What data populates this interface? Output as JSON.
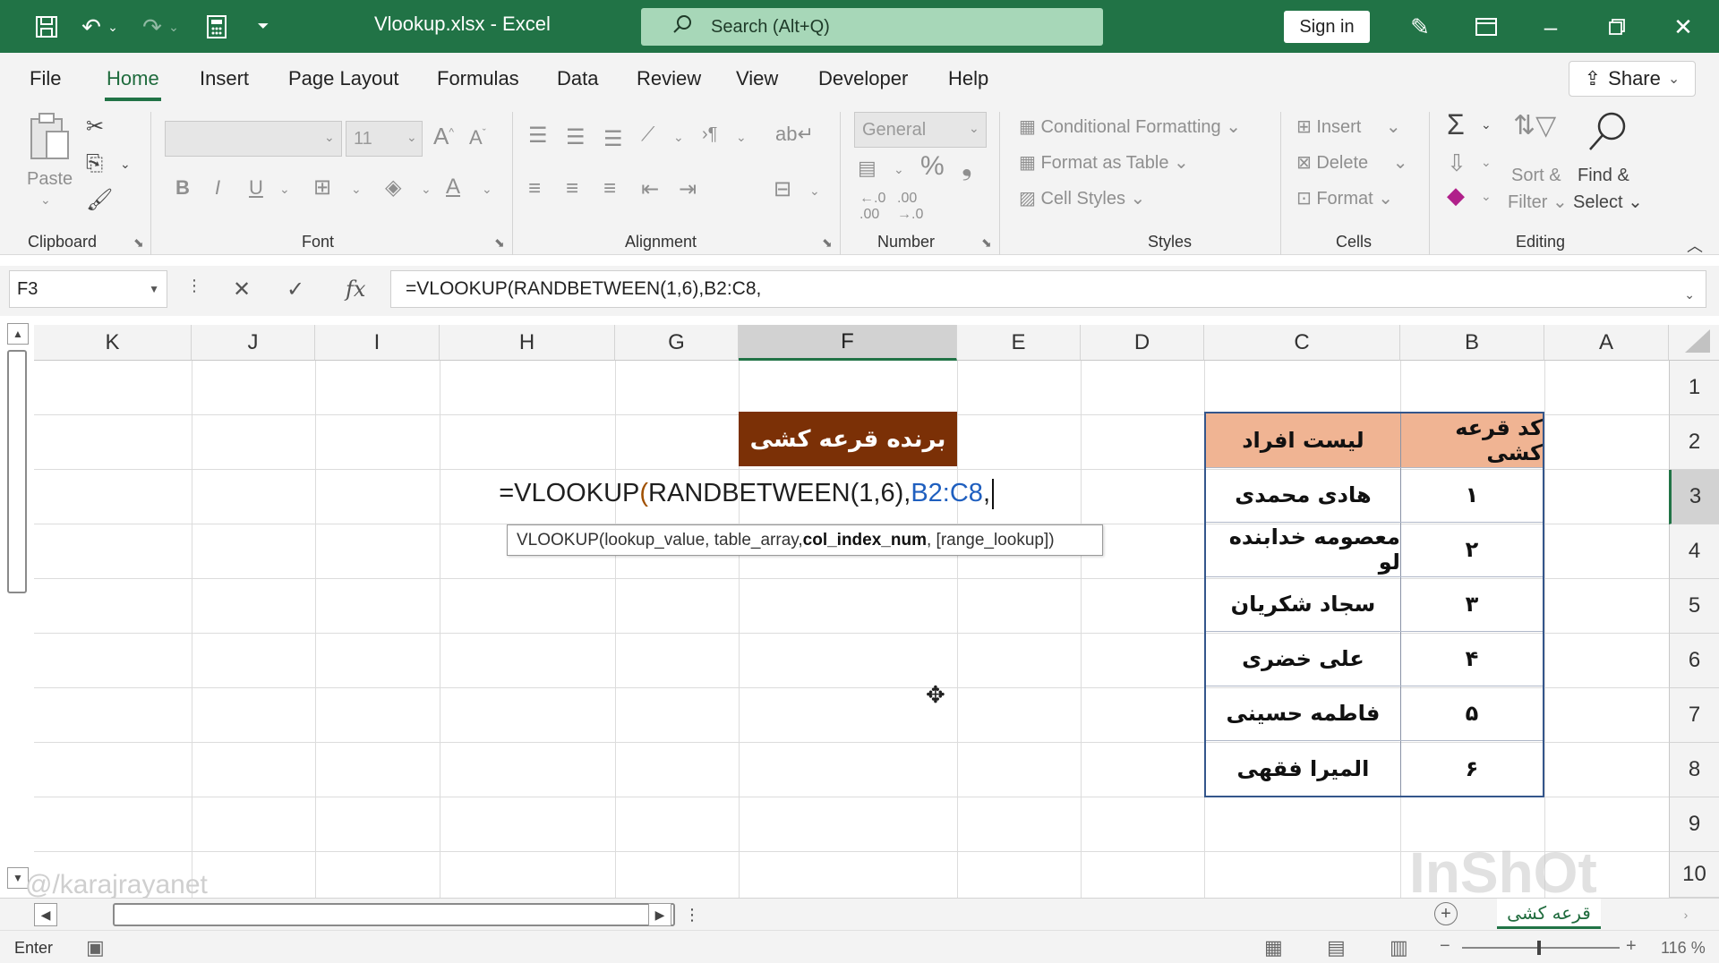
{
  "titlebar": {
    "title": "Vlookup.xlsx  -  Excel",
    "search_placeholder": "Search (Alt+Q)",
    "signin_label": "Sign in"
  },
  "menu": {
    "tabs": [
      "File",
      "Home",
      "Insert",
      "Page Layout",
      "Formulas",
      "Data",
      "Review",
      "View",
      "Developer",
      "Help"
    ],
    "share_label": "Share"
  },
  "ribbon": {
    "clipboard": {
      "label": "Clipboard",
      "paste": "Paste"
    },
    "font": {
      "label": "Font",
      "size": "11"
    },
    "alignment": {
      "label": "Alignment"
    },
    "number": {
      "label": "Number",
      "format": "General"
    },
    "styles": {
      "label": "Styles",
      "conditional": "Conditional Formatting",
      "format_table": "Format as Table",
      "cell_styles": "Cell Styles"
    },
    "cells": {
      "label": "Cells",
      "insert": "Insert",
      "delete": "Delete",
      "format": "Format"
    },
    "editing": {
      "label": "Editing",
      "sort": "Sort &",
      "filter": "Filter",
      "find": "Find &",
      "select": "Select"
    }
  },
  "formula_bar": {
    "name_box": "F3",
    "formula": "=VLOOKUP(RANDBETWEEN(1,6),B2:C8,"
  },
  "grid": {
    "columns": [
      "K",
      "J",
      "I",
      "H",
      "G",
      "F",
      "E",
      "D",
      "C",
      "B",
      "A"
    ],
    "rows": [
      "1",
      "2",
      "3",
      "4",
      "5",
      "6",
      "7",
      "8",
      "9",
      "10"
    ],
    "winner_header": "برنده قرعه کشی",
    "edit_text": {
      "prefix": "=VLOOKUP",
      "open": "(",
      "func": "RANDBETWEEN",
      "args": "(1,6)",
      "comma": ",",
      "range": "B2:C8",
      "trail": ","
    },
    "tooltip": {
      "start": "VLOOKUP(lookup_value, table_array, ",
      "bold": "col_index_num",
      "end": ", [range_lookup])"
    },
    "table": {
      "header_name": "لیست افراد",
      "header_code": "کد قرعه کشی",
      "rows": [
        {
          "name": "هادی محمدی",
          "code": "۱"
        },
        {
          "name": "معصومه خدابنده لو",
          "code": "۲"
        },
        {
          "name": "سجاد شکریان",
          "code": "۳"
        },
        {
          "name": "علی خضری",
          "code": "۴"
        },
        {
          "name": "فاطمه حسینی",
          "code": "۵"
        },
        {
          "name": "المیرا فقهی",
          "code": "۶"
        }
      ]
    },
    "watermark_left": "@/karajrayanet",
    "watermark_right": "InShOt"
  },
  "sheet_tabs": {
    "active": "قرعه کشی"
  },
  "statusbar": {
    "mode": "Enter",
    "zoom": "116 %"
  },
  "colors": {
    "accent": "#217346",
    "winner_bg": "#7b3006",
    "table_header": "#f0b493",
    "table_border": "#34568b"
  }
}
